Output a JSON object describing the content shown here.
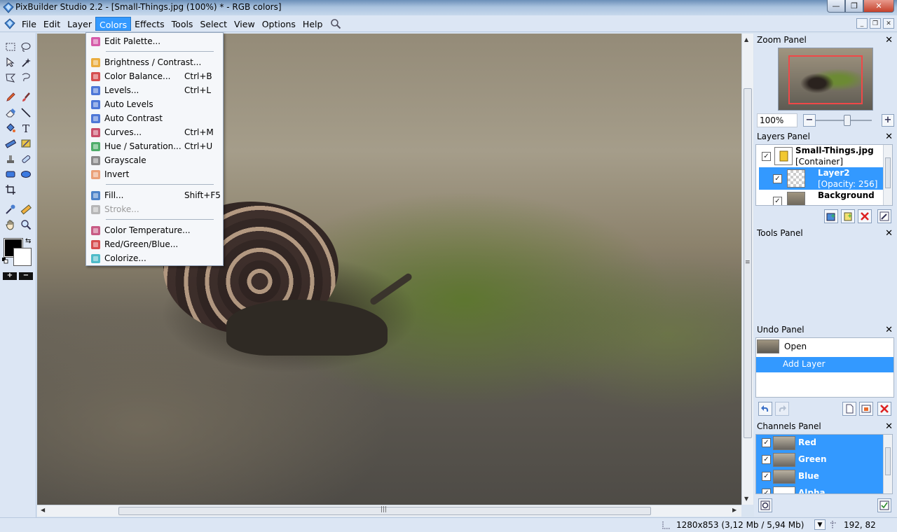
{
  "window": {
    "title": "PixBuilder Studio 2.2 - [Small-Things.jpg (100%) * - RGB colors]",
    "minimize": "—",
    "maximize": "❐",
    "close": "✕"
  },
  "menubar": {
    "items": [
      "File",
      "Edit",
      "Layer",
      "Colors",
      "Effects",
      "Tools",
      "Select",
      "View",
      "Options",
      "Help"
    ],
    "active": "Colors",
    "search_icon": "magnifier-icon",
    "mdi_minimize": "_",
    "mdi_restore": "❐",
    "mdi_close": "✕"
  },
  "colors_menu": [
    {
      "label": "Edit Palette...",
      "key": "",
      "icon": "palette-icon",
      "color": "#d0409a"
    },
    {
      "sep": true
    },
    {
      "label": "Brightness / Contrast...",
      "key": "",
      "icon": "sun-icon",
      "color": "#e8a020"
    },
    {
      "label": "Color Balance...",
      "key": "Ctrl+B",
      "icon": "balance-icon",
      "color": "#d03030"
    },
    {
      "label": "Levels...",
      "key": "Ctrl+L",
      "icon": "levels-icon",
      "color": "#3060d0"
    },
    {
      "label": "Auto Levels",
      "key": "",
      "icon": "auto-levels-icon",
      "color": "#3060d0"
    },
    {
      "label": "Auto Contrast",
      "key": "",
      "icon": "auto-contrast-icon",
      "color": "#3060d0"
    },
    {
      "label": "Curves...",
      "key": "Ctrl+M",
      "icon": "curves-icon",
      "color": "#c03050"
    },
    {
      "label": "Hue / Saturation...",
      "key": "Ctrl+U",
      "icon": "hue-icon",
      "color": "#30a050"
    },
    {
      "label": "Grayscale",
      "key": "",
      "icon": "grayscale-icon",
      "color": "#777777"
    },
    {
      "label": "Invert",
      "key": "",
      "icon": "invert-icon",
      "color": "#e89060"
    },
    {
      "sep": true
    },
    {
      "label": "Fill...",
      "key": "Shift+F5",
      "icon": "fill-bucket-icon",
      "color": "#3070c0"
    },
    {
      "label": "Stroke...",
      "key": "",
      "icon": "stroke-icon",
      "color": "#aaaaaa",
      "disabled": true
    },
    {
      "sep": true
    },
    {
      "label": "Color Temperature...",
      "key": "",
      "icon": "temperature-icon",
      "color": "#c04070"
    },
    {
      "label": "Red/Green/Blue...",
      "key": "",
      "icon": "rgb-icon",
      "color": "#d03030"
    },
    {
      "label": "Colorize...",
      "key": "",
      "icon": "colorize-icon",
      "color": "#30b0c0"
    }
  ],
  "zoom_panel": {
    "title": "Zoom Panel",
    "value": "100%",
    "zoom_out": "−",
    "zoom_in": "+",
    "zoom_level": 1.0
  },
  "layers_panel": {
    "title": "Layers Panel",
    "layers": [
      {
        "name": "Small-Things.jpg",
        "sub": "[Container]",
        "checked": true,
        "selected": false
      },
      {
        "name": "Layer2",
        "sub": "[Opacity: 256]",
        "checked": true,
        "selected": true
      },
      {
        "name": "Background",
        "sub": "",
        "checked": true,
        "selected": false
      }
    ]
  },
  "tools_panel": {
    "title": "Tools Panel"
  },
  "undo_panel": {
    "title": "Undo Panel",
    "items": [
      {
        "label": "Open",
        "selected": false
      },
      {
        "label": "Add Layer",
        "selected": true
      }
    ]
  },
  "channels_panel": {
    "title": "Channels Panel",
    "channels": [
      {
        "name": "Red",
        "checked": true
      },
      {
        "name": "Green",
        "checked": true
      },
      {
        "name": "Blue",
        "checked": true
      },
      {
        "name": "Alpha",
        "checked": true
      }
    ]
  },
  "toolbox": {
    "swap": "⇆",
    "zoom_plus": "+",
    "zoom_minus": "−",
    "foreground": "#000000",
    "background": "#ffffff"
  },
  "statusbar": {
    "image_info": "1280x853 (3,12 Mb / 5,94 Mb)",
    "coords": "192, 82"
  },
  "colors": {
    "accent": "#3399ff",
    "chrome": "#dce6f4"
  }
}
